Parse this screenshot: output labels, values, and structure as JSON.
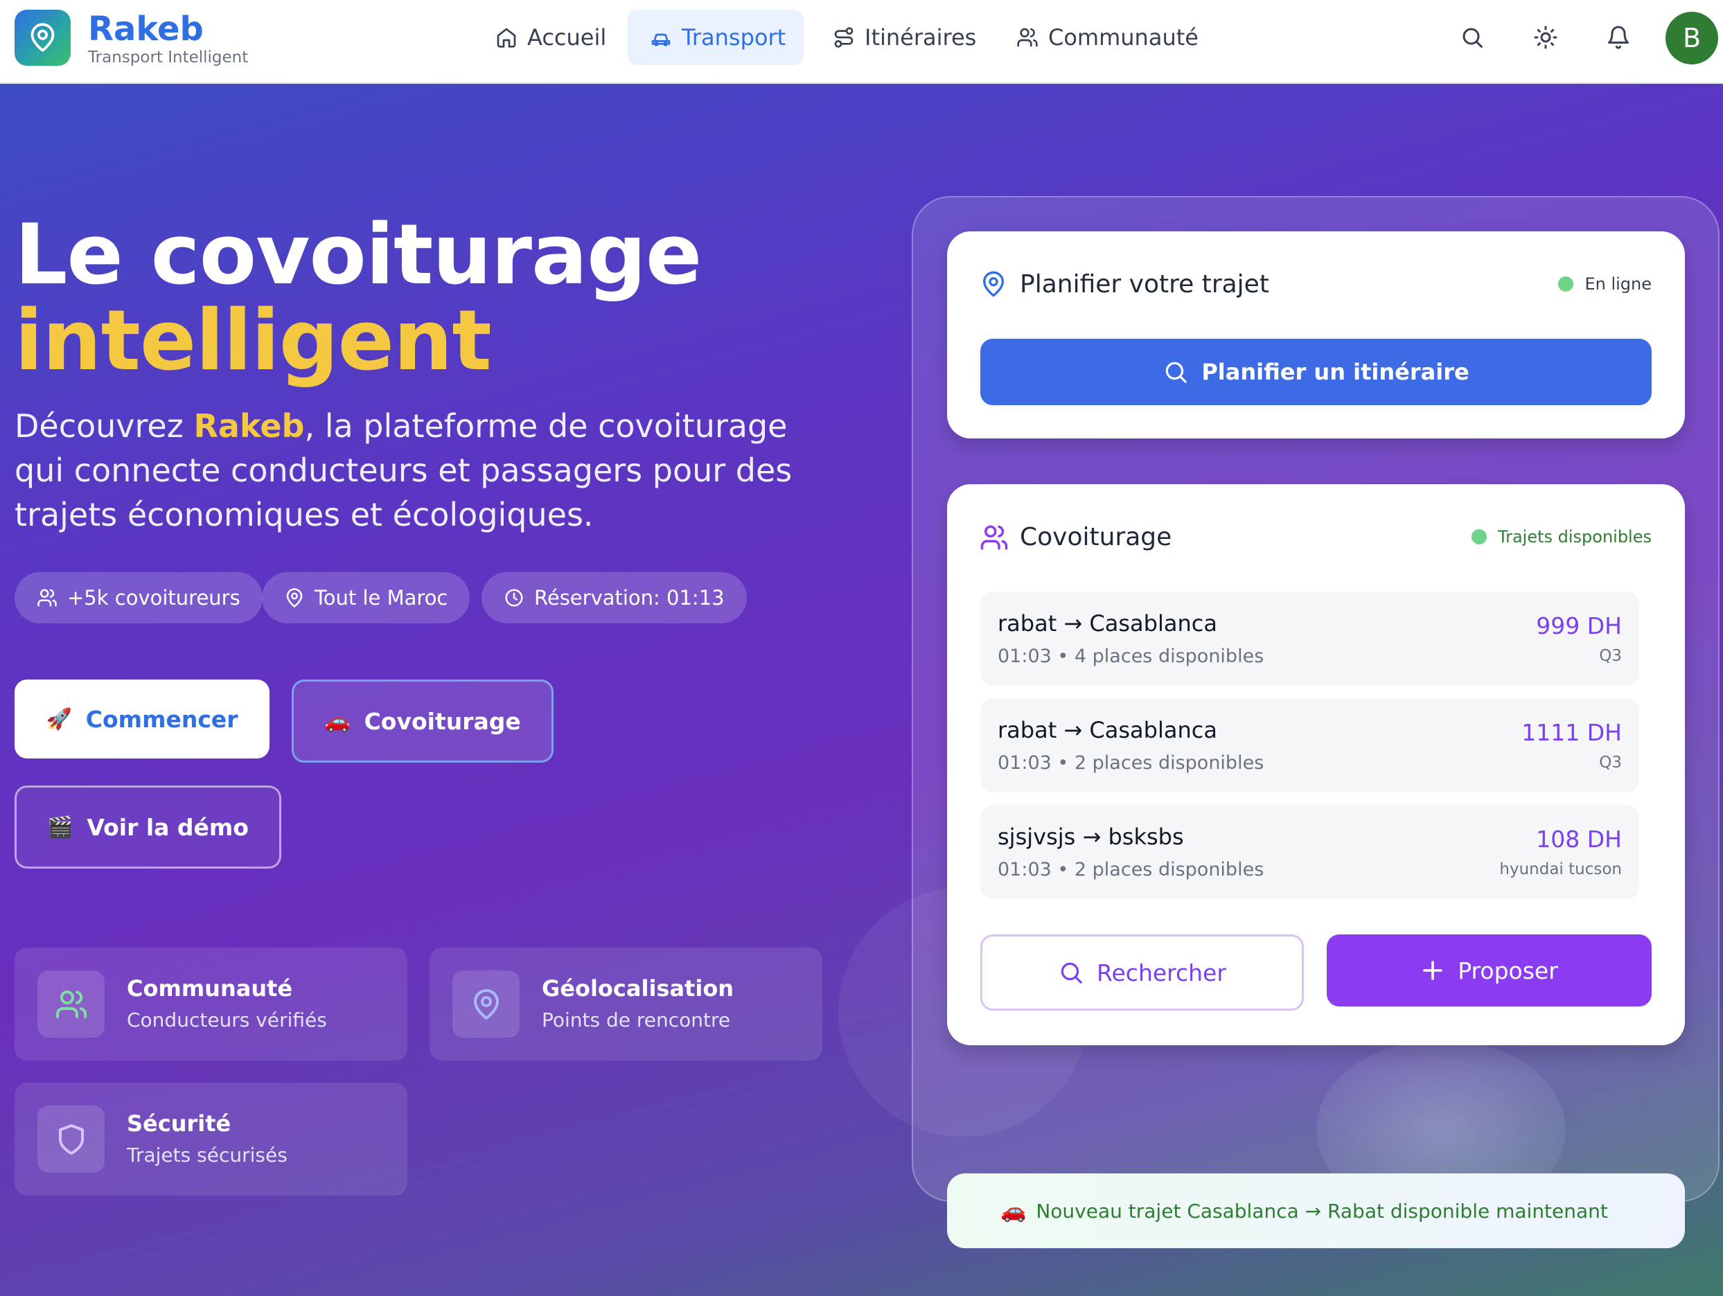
{
  "brand": {
    "name": "Rakeb",
    "tagline": "Transport Intelligent",
    "icon": "map-pin-icon"
  },
  "nav": [
    {
      "label": "Accueil",
      "icon": "home-icon",
      "active": false
    },
    {
      "label": "Transport",
      "icon": "car-icon",
      "active": true
    },
    {
      "label": "Itinéraires",
      "icon": "route-icon",
      "active": false
    },
    {
      "label": "Communauté",
      "icon": "users-icon",
      "active": false
    }
  ],
  "header_actions": {
    "icons": [
      "search-icon",
      "sun-icon",
      "bell-icon"
    ],
    "avatar_letter": "B"
  },
  "hero": {
    "title_line1": "Le covoiturage",
    "title_line2": "intelligent",
    "desc_prefix": "Découvrez ",
    "desc_brand": "Rakeb",
    "desc_suffix": ", la plateforme de covoiturage qui connecte conducteurs et passagers pour des trajets économiques et écologiques.",
    "pills": [
      {
        "label": "+5k covoitureurs",
        "icon": "users-icon"
      },
      {
        "label": "Tout le Maroc",
        "icon": "map-pin-icon"
      },
      {
        "label": "Réservation: 01:13",
        "icon": "clock-icon"
      }
    ],
    "buttons": {
      "start": {
        "emoji": "🚀",
        "label": "Commencer"
      },
      "carpool": {
        "emoji": "🚗",
        "label": "Covoiturage"
      },
      "demo": {
        "emoji": "🎬",
        "label": "Voir la démo"
      }
    },
    "features": [
      {
        "title": "Communauté",
        "subtitle": "Conducteurs vérifiés",
        "icon": "users-icon"
      },
      {
        "title": "Géolocalisation",
        "subtitle": "Points de rencontre",
        "icon": "map-pin-icon"
      },
      {
        "title": "Sécurité",
        "subtitle": "Trajets sécurisés",
        "icon": "shield-icon"
      }
    ]
  },
  "plan_card": {
    "title": "Planifier votre trajet",
    "status": "En ligne",
    "button": "Planifier un itinéraire"
  },
  "carpool_card": {
    "title": "Covoiturage",
    "status": "Trajets disponibles",
    "trips": [
      {
        "from": "rabat",
        "to": "Casablanca",
        "time": "01:03",
        "seats": "4 places disponibles",
        "price": "999 DH",
        "vehicle": "Q3"
      },
      {
        "from": "rabat",
        "to": "Casablanca",
        "time": "01:03",
        "seats": "2 places disponibles",
        "price": "1111 DH",
        "vehicle": "Q3"
      },
      {
        "from": "sjsjvsjs",
        "to": "bsksbs",
        "time": "01:03",
        "seats": "2 places disponibles",
        "price": "108 DH",
        "vehicle": "hyundai tucson"
      }
    ],
    "search_button": "Rechercher",
    "propose_button": "Proposer"
  },
  "notice": {
    "emoji": "🚗",
    "text": "Nouveau trajet Casablanca → Rabat disponible maintenant"
  },
  "colors": {
    "primary": "#2f6fe4",
    "accent_yellow": "#f5c842",
    "purple": "#8b3cf0",
    "success": "#2e7d32"
  }
}
